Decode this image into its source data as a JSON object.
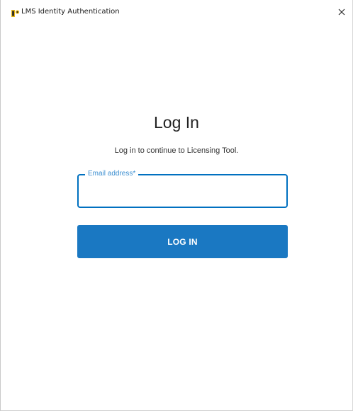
{
  "window": {
    "title": "LMS Identity Authentication",
    "app_icon": "lms-logo-icon",
    "close_icon": "close-icon",
    "close_glyph": "✕"
  },
  "login": {
    "heading": "Log In",
    "subtitle": "Log in to continue to Licensing Tool.",
    "email_label": "Email address*",
    "email_value": "",
    "button_label": "LOG IN"
  },
  "colors": {
    "accent": "#1a78c2",
    "field_border": "#0070c0",
    "field_label": "#3b8ed0"
  }
}
